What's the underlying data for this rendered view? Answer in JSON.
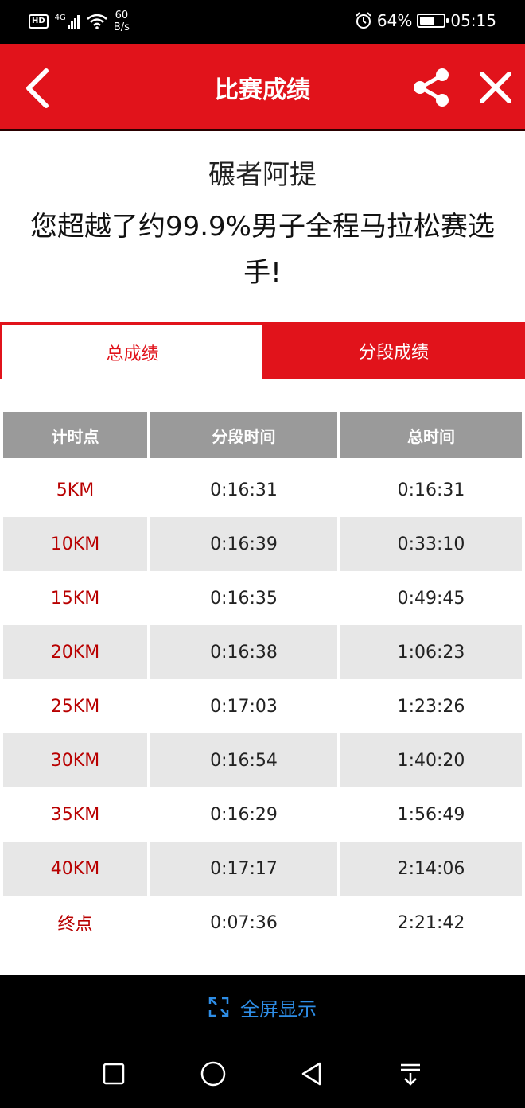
{
  "status_bar": {
    "hd": "HD",
    "network": "4G",
    "speed_value": "60",
    "speed_unit": "B/s",
    "battery": "64%",
    "battery_level": 0.64,
    "time": "05:15"
  },
  "header": {
    "title": "比赛成绩"
  },
  "result": {
    "runner_name": "碾者阿提",
    "summary": "您超越了约99.9%男子全程马拉松赛选手!"
  },
  "tabs": [
    {
      "label": "总成绩",
      "active": true
    },
    {
      "label": "分段成绩",
      "active": false
    }
  ],
  "table": {
    "headers": [
      "计时点",
      "分段时间",
      "总时间"
    ],
    "rows": [
      [
        "5KM",
        "0:16:31",
        "0:16:31"
      ],
      [
        "10KM",
        "0:16:39",
        "0:33:10"
      ],
      [
        "15KM",
        "0:16:35",
        "0:49:45"
      ],
      [
        "20KM",
        "0:16:38",
        "1:06:23"
      ],
      [
        "25KM",
        "0:17:03",
        "1:23:26"
      ],
      [
        "30KM",
        "0:16:54",
        "1:40:20"
      ],
      [
        "35KM",
        "0:16:29",
        "1:56:49"
      ],
      [
        "40KM",
        "0:17:17",
        "2:14:06"
      ],
      [
        "终点",
        "0:07:36",
        "2:21:42"
      ]
    ]
  },
  "footer": {
    "fullscreen_label": "全屏显示"
  },
  "colors": {
    "brand_red": "#e1131b",
    "checkpoint_red": "#b80000",
    "header_gray": "#9a9a9a",
    "stripe_gray": "#e7e7e7",
    "link_blue": "#2e8de6"
  },
  "icons": {
    "back": "chevron-left-icon",
    "share": "share-icon",
    "close": "close-icon",
    "fullscreen": "expand-icon",
    "nav_recent": "square-icon",
    "nav_home": "circle-icon",
    "nav_back": "triangle-back-icon",
    "nav_notifications": "pull-down-icon"
  }
}
